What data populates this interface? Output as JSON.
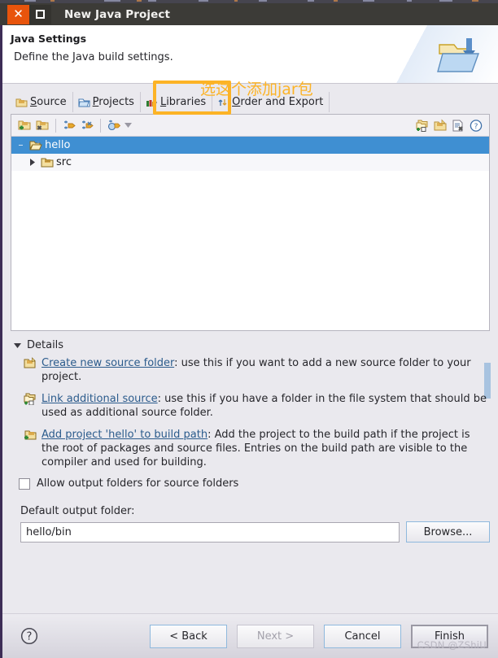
{
  "window": {
    "title": "New Java Project",
    "close_label": "✕",
    "maximize_label": "",
    "left_border_color": "#3d2d56",
    "titlebar_color": "#3c3b37"
  },
  "banner": {
    "heading": "Java Settings",
    "subheading": "Define the Java build settings.",
    "icon_name": "java-project-folder-icon"
  },
  "annotation": {
    "text": "选这个添加jar包",
    "color": "#fcb326",
    "highlight_target": "Libraries"
  },
  "tabs": [
    {
      "label": "Source",
      "mnemonic": "S",
      "rest": "ource",
      "icon": "source-folder-icon",
      "active": true
    },
    {
      "label": "Projects",
      "mnemonic": "P",
      "rest": "rojects",
      "icon": "projects-folder-icon",
      "active": false
    },
    {
      "label": "Libraries",
      "mnemonic": "L",
      "rest": "ibraries",
      "icon": "libraries-books-icon",
      "active": false
    },
    {
      "label": "Order and Export",
      "mnemonic": "O",
      "rest": "rder and Export",
      "icon": "order-export-arrows-icon",
      "active": false
    }
  ],
  "tree_toolbar": {
    "left_icons": [
      "add-source-folder-icon",
      "remove-source-folder-icon",
      "edit-inclusion-filter-icon",
      "edit-exclusion-filter-icon",
      "configure-output-folder-icon"
    ],
    "dropdown_icon": "chevron-down-icon",
    "right_icons": [
      "link-source-icon",
      "create-new-folder-icon",
      "remove-entry-icon",
      "help-icon"
    ]
  },
  "tree": {
    "rows": [
      {
        "label": "hello",
        "icon": "open-project-folder-icon",
        "selected": true,
        "indent": 0,
        "twisty": "collapsed-dot"
      },
      {
        "label": "src",
        "icon": "source-package-folder-icon",
        "selected": false,
        "indent": 1,
        "twisty": "collapsed-triangle"
      }
    ]
  },
  "details": {
    "section_label": "Details",
    "expanded": true,
    "items": [
      {
        "icon": "create-source-folder-icon",
        "link": "Create new source folder",
        "text": ": use this if you want to add a new source folder to your project."
      },
      {
        "icon": "link-source-icon",
        "link": "Link additional source",
        "text": ": use this if you have a folder in the file system that should be used as additional source folder."
      },
      {
        "icon": "add-to-buildpath-icon",
        "link": "Add project 'hello' to build path",
        "text": ": Add the project to the build path if the project is the root of packages and source files. Entries on the build path are visible to the compiler and used for building."
      }
    ]
  },
  "allow_output_folders": {
    "label": "Allow output folders for source folders",
    "checked": false
  },
  "output_folder": {
    "label": "Default output folder:",
    "value": "hello/bin",
    "browse_label": "Browse..."
  },
  "footer": {
    "help_icon": "help-question-icon",
    "buttons": [
      {
        "label": "< Back",
        "state": "enabled"
      },
      {
        "label": "Next >",
        "state": "disabled"
      },
      {
        "label": "Cancel",
        "state": "enabled"
      },
      {
        "label": "Finish",
        "state": "default"
      }
    ]
  },
  "watermark": {
    "text": "CSDN @ZShiU"
  }
}
